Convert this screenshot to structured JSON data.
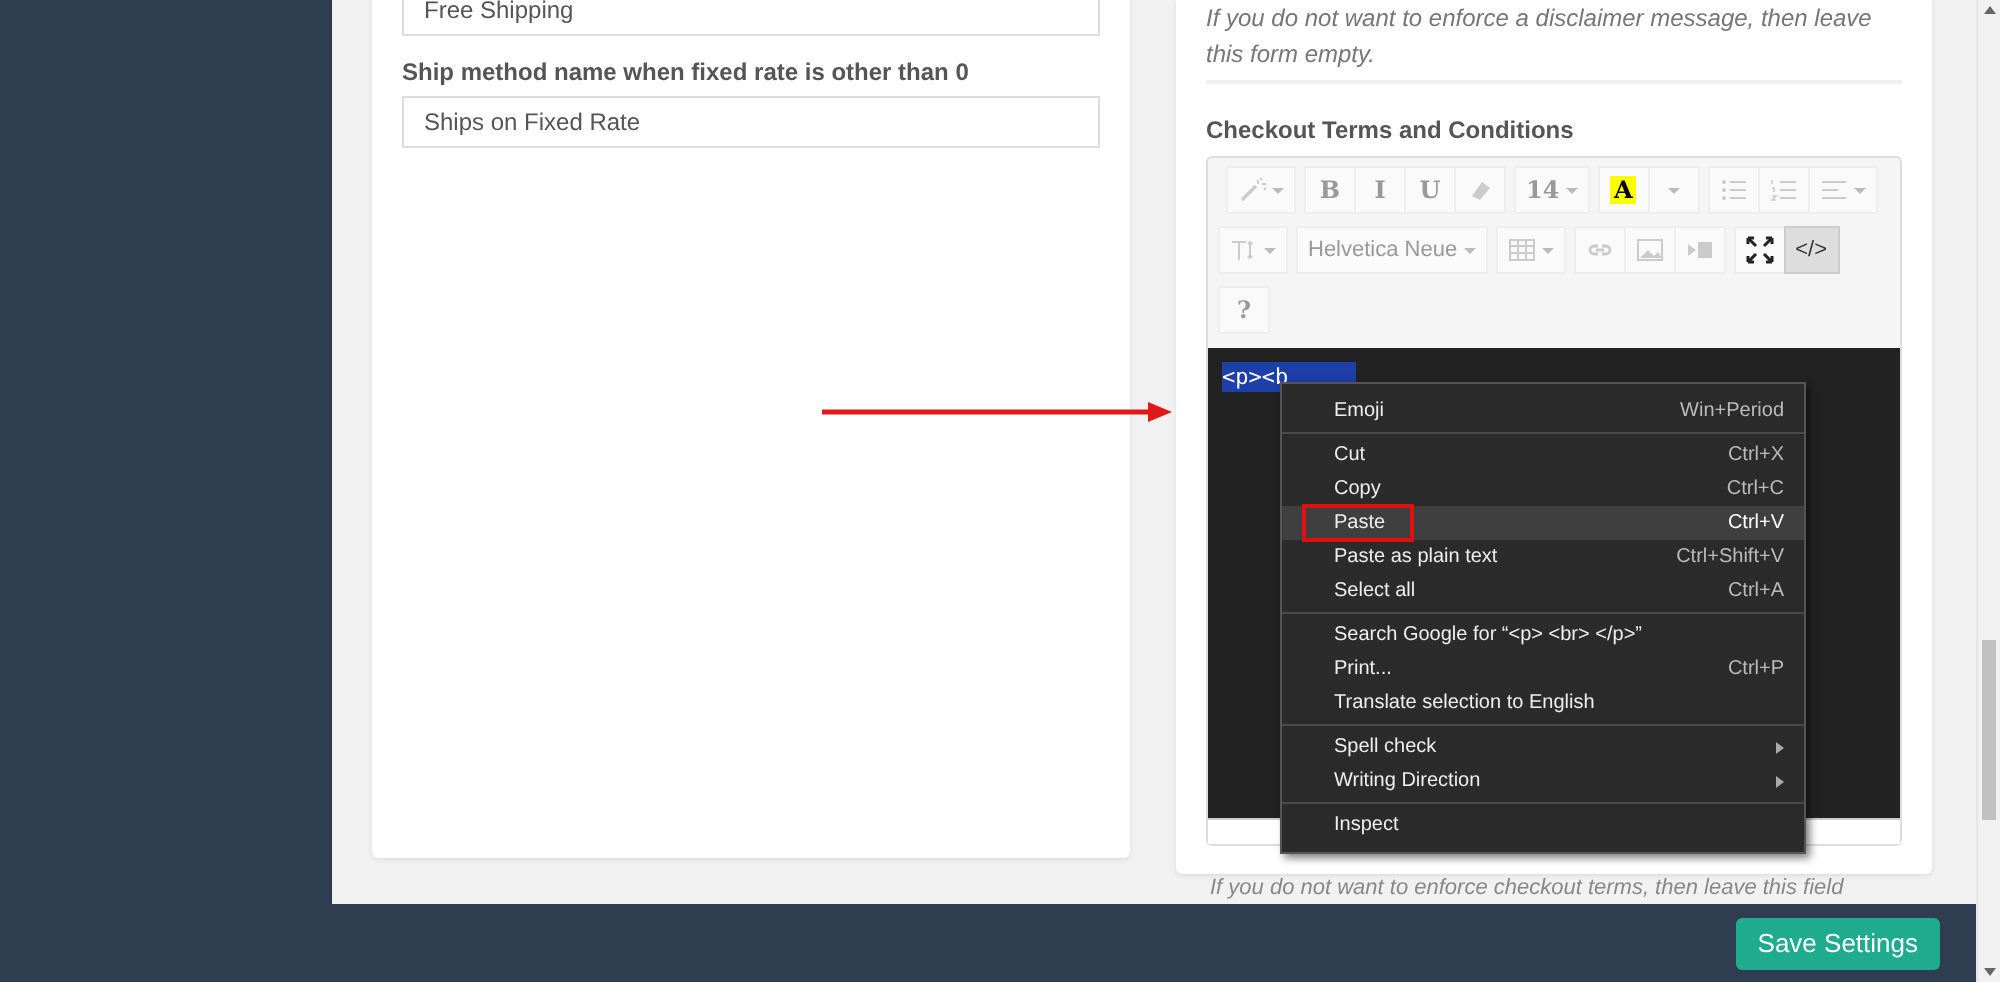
{
  "left_card": {
    "fields": [
      {
        "value": "Free Shipping"
      },
      {
        "label": "Ship method name when fixed rate is other than 0",
        "value": "Ships on Fixed Rate"
      }
    ]
  },
  "right_card": {
    "hint_top": "If you do not want to enforce a disclaimer message, then leave this form empty.",
    "title": "Checkout Terms and Conditions",
    "editor": {
      "rows": [
        [
          [
            {
              "kind": "icon",
              "caret": true,
              "disabled": true,
              "active": false
            }
          ],
          [
            {
              "kind": "text",
              "label": "B",
              "disabled": true,
              "active": false
            },
            {
              "kind": "text",
              "label": "I",
              "disabled": true,
              "active": false
            },
            {
              "kind": "text",
              "label": "U",
              "disabled": true,
              "active": false
            },
            {
              "kind": "icon",
              "caret": false,
              "disabled": true,
              "active": false
            }
          ],
          [
            {
              "kind": "text",
              "label": "14",
              "caret": true,
              "disabled": true,
              "active": false
            }
          ],
          [
            {
              "kind": "color",
              "label": "A",
              "disabled": false,
              "active": false
            },
            {
              "kind": "caret",
              "disabled": true,
              "active": false
            }
          ],
          [
            {
              "kind": "icon",
              "caret": false,
              "disabled": true,
              "active": false
            },
            {
              "kind": "icon",
              "caret": false,
              "disabled": true,
              "active": false
            },
            {
              "kind": "icon",
              "caret": true,
              "disabled": true,
              "active": false
            }
          ]
        ],
        [
          [
            {
              "kind": "icon",
              "caret": true,
              "disabled": true,
              "active": false
            }
          ],
          [
            {
              "kind": "text",
              "label": "Helvetica Neue",
              "caret": true,
              "disabled": true,
              "active": false
            }
          ],
          [
            {
              "kind": "icon",
              "caret": true,
              "disabled": true,
              "active": false
            }
          ],
          [
            {
              "kind": "icon",
              "caret": false,
              "disabled": true,
              "active": false
            },
            {
              "kind": "icon",
              "caret": false,
              "disabled": true,
              "active": false
            },
            {
              "kind": "icon",
              "caret": false,
              "disabled": true,
              "active": false
            }
          ],
          [
            {
              "kind": "icon",
              "caret": false,
              "disabled": false,
              "active": false
            },
            {
              "kind": "text",
              "label": "</>",
              "disabled": false,
              "active": true
            }
          ]
        ],
        [
          [
            {
              "kind": "text",
              "label": "?",
              "disabled": true,
              "active": false
            }
          ]
        ]
      ],
      "code_text": "<p><b"
    },
    "hint_bottom": "If you do not want to enforce checkout terms, then leave this field"
  },
  "context_menu": {
    "groups": [
      {
        "items": [
          {
            "label": "Emoji",
            "shortcut": "Win+Period",
            "selected": false,
            "outlined": false,
            "submenu": false
          }
        ]
      },
      {
        "items": [
          {
            "label": "Cut",
            "shortcut": "Ctrl+X",
            "selected": false,
            "outlined": false,
            "submenu": false
          },
          {
            "label": "Copy",
            "shortcut": "Ctrl+C",
            "selected": false,
            "outlined": false,
            "submenu": false
          },
          {
            "label": "Paste",
            "shortcut": "Ctrl+V",
            "selected": true,
            "outlined": true,
            "submenu": false
          },
          {
            "label": "Paste as plain text",
            "shortcut": "Ctrl+Shift+V",
            "selected": false,
            "outlined": false,
            "submenu": false
          },
          {
            "label": "Select all",
            "shortcut": "Ctrl+A",
            "selected": false,
            "outlined": false,
            "submenu": false
          }
        ]
      },
      {
        "items": [
          {
            "label": "Search Google for “<p> <br> </p>”",
            "selected": false,
            "outlined": false,
            "submenu": false
          },
          {
            "label": "Print...",
            "shortcut": "Ctrl+P",
            "selected": false,
            "outlined": false,
            "submenu": false
          },
          {
            "label": "Translate selection to English",
            "selected": false,
            "outlined": false,
            "submenu": false
          }
        ]
      },
      {
        "items": [
          {
            "label": "Spell check",
            "selected": false,
            "outlined": false,
            "submenu": true
          },
          {
            "label": "Writing Direction",
            "selected": false,
            "outlined": false,
            "submenu": true
          }
        ]
      },
      {
        "items": [
          {
            "label": "Inspect",
            "selected": false,
            "outlined": false,
            "submenu": false
          }
        ]
      }
    ]
  },
  "save_button": "Save Settings"
}
